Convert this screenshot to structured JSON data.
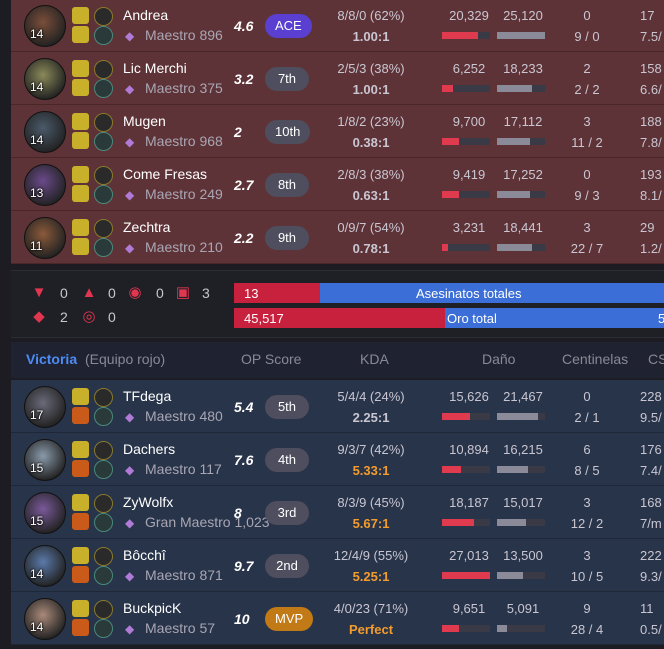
{
  "colors": {
    "loss_bg": "#5e3337",
    "win_bg": "#283449",
    "red_bar": "#e03a4e",
    "blue_bar": "#3b6ed6",
    "ace": "#5a3fd1",
    "mvp": "#c27a17",
    "victory_blue": "#4d8cf5",
    "kda_gold": "#f39c2d"
  },
  "red_team": [
    {
      "name": "Andrea",
      "level": "14",
      "rank": "Maestro 896",
      "score": "4.6",
      "place": "ACE",
      "kda": "8/8/0 (62%)",
      "ratio": "1.00:1",
      "dmg_dealt": "20,329",
      "dmg_taken": "25,120",
      "dealt_frac": 0.76,
      "taken_frac": 1.0,
      "wards1": "0",
      "wards2": "9 / 0",
      "cs1": "17",
      "cs2": "7.5/",
      "champ_color": "#7a4e3a"
    },
    {
      "name": "Lic Merchi",
      "level": "14",
      "rank": "Maestro 375",
      "score": "3.2",
      "place": "7th",
      "kda": "2/5/3 (38%)",
      "ratio": "1.00:1",
      "dmg_dealt": "6,252",
      "dmg_taken": "18,233",
      "dealt_frac": 0.23,
      "taken_frac": 0.73,
      "wards1": "2",
      "wards2": "2 / 2",
      "cs1": "158",
      "cs2": "6.6/",
      "champ_color": "#8a8a5a"
    },
    {
      "name": "Mugen",
      "level": "14",
      "rank": "Maestro 968",
      "score": "2",
      "place": "10th",
      "kda": "1/8/2 (23%)",
      "ratio": "0.38:1",
      "dmg_dealt": "9,700",
      "dmg_taken": "17,112",
      "dealt_frac": 0.36,
      "taken_frac": 0.68,
      "wards1": "3",
      "wards2": "11 / 2",
      "cs1": "188",
      "cs2": "7.8/",
      "champ_color": "#4a5a6a"
    },
    {
      "name": "Come Fresas",
      "level": "13",
      "rank": "Maestro 249",
      "score": "2.7",
      "place": "8th",
      "kda": "2/8/3 (38%)",
      "ratio": "0.63:1",
      "dmg_dealt": "9,419",
      "dmg_taken": "17,252",
      "dealt_frac": 0.35,
      "taken_frac": 0.69,
      "wards1": "0",
      "wards2": "9 / 3",
      "cs1": "193",
      "cs2": "8.1/",
      "champ_color": "#6a4a8a"
    },
    {
      "name": "Zechtra",
      "level": "11",
      "rank": "Maestro 210",
      "score": "2.2",
      "place": "9th",
      "kda": "0/9/7 (54%)",
      "ratio": "0.78:1",
      "dmg_dealt": "3,231",
      "dmg_taken": "18,441",
      "dealt_frac": 0.12,
      "taken_frac": 0.73,
      "wards1": "3",
      "wards2": "22 / 7",
      "cs1": "29",
      "cs2": "1.2/",
      "champ_color": "#8a5a3a"
    }
  ],
  "objectives": {
    "red": [
      "0",
      "0",
      "0",
      "3"
    ],
    "red2": [
      "2",
      "0"
    ]
  },
  "totals": {
    "kills_label": "Asesinatos totales",
    "kills_red": "13",
    "kills_red_frac": 0.2,
    "kills_blue": "",
    "gold_label": "Oro total",
    "gold_red": "45,517",
    "gold_red_frac": 0.49,
    "gold_blue": "5"
  },
  "header": {
    "team": "Victoria",
    "team_sub": "(Equipo rojo)",
    "op": "OP Score",
    "kda": "KDA",
    "dmg": "Daño",
    "wards": "Centinelas",
    "cs": "CS"
  },
  "blue_team": [
    {
      "name": "TFdega",
      "level": "17",
      "rank": "Maestro 480",
      "score": "5.4",
      "place": "5th",
      "kda": "5/4/4 (24%)",
      "ratio": "2.25:1",
      "ratio_gold": false,
      "dmg_dealt": "15,626",
      "dmg_taken": "21,467",
      "dealt_frac": 0.58,
      "taken_frac": 0.85,
      "wards1": "0",
      "wards2": "2 / 1",
      "cs1": "228",
      "cs2": "9.5/",
      "champ_color": "#6a6a7a"
    },
    {
      "name": "Dachers",
      "level": "15",
      "rank": "Maestro 117",
      "score": "7.6",
      "place": "4th",
      "kda": "9/3/7 (42%)",
      "ratio": "5.33:1",
      "ratio_gold": true,
      "dmg_dealt": "10,894",
      "dmg_taken": "16,215",
      "dealt_frac": 0.4,
      "taken_frac": 0.64,
      "wards1": "6",
      "wards2": "8 / 5",
      "cs1": "176",
      "cs2": "7.4/",
      "champ_color": "#8a9aaa"
    },
    {
      "name": "ZyWolfx",
      "level": "15",
      "rank": "Gran Maestro 1,023",
      "score": "8",
      "place": "3rd",
      "kda": "8/3/9 (45%)",
      "ratio": "5.67:1",
      "ratio_gold": true,
      "dmg_dealt": "18,187",
      "dmg_taken": "15,017",
      "dealt_frac": 0.67,
      "taken_frac": 0.6,
      "wards1": "3",
      "wards2": "12 / 2",
      "cs1": "168",
      "cs2": "7/m",
      "champ_color": "#7a5a9a"
    },
    {
      "name": "Bôcchî",
      "level": "14",
      "rank": "Maestro 871",
      "score": "9.7",
      "place": "2nd",
      "kda": "12/4/9 (55%)",
      "ratio": "5.25:1",
      "ratio_gold": true,
      "dmg_dealt": "27,013",
      "dmg_taken": "13,500",
      "dealt_frac": 1.0,
      "taken_frac": 0.54,
      "wards1": "3",
      "wards2": "10 / 5",
      "cs1": "222",
      "cs2": "9.3/",
      "champ_color": "#5a7aaa"
    },
    {
      "name": "BuckpicK",
      "level": "14",
      "rank": "Maestro 57",
      "score": "10",
      "place": "MVP",
      "kda": "4/0/23 (71%)",
      "ratio": "Perfect",
      "ratio_gold": true,
      "dmg_dealt": "9,651",
      "dmg_taken": "5,091",
      "dealt_frac": 0.36,
      "taken_frac": 0.2,
      "wards1": "9",
      "wards2": "28 / 4",
      "cs1": "11",
      "cs2": "0.5/",
      "champ_color": "#aa8a7a"
    }
  ]
}
